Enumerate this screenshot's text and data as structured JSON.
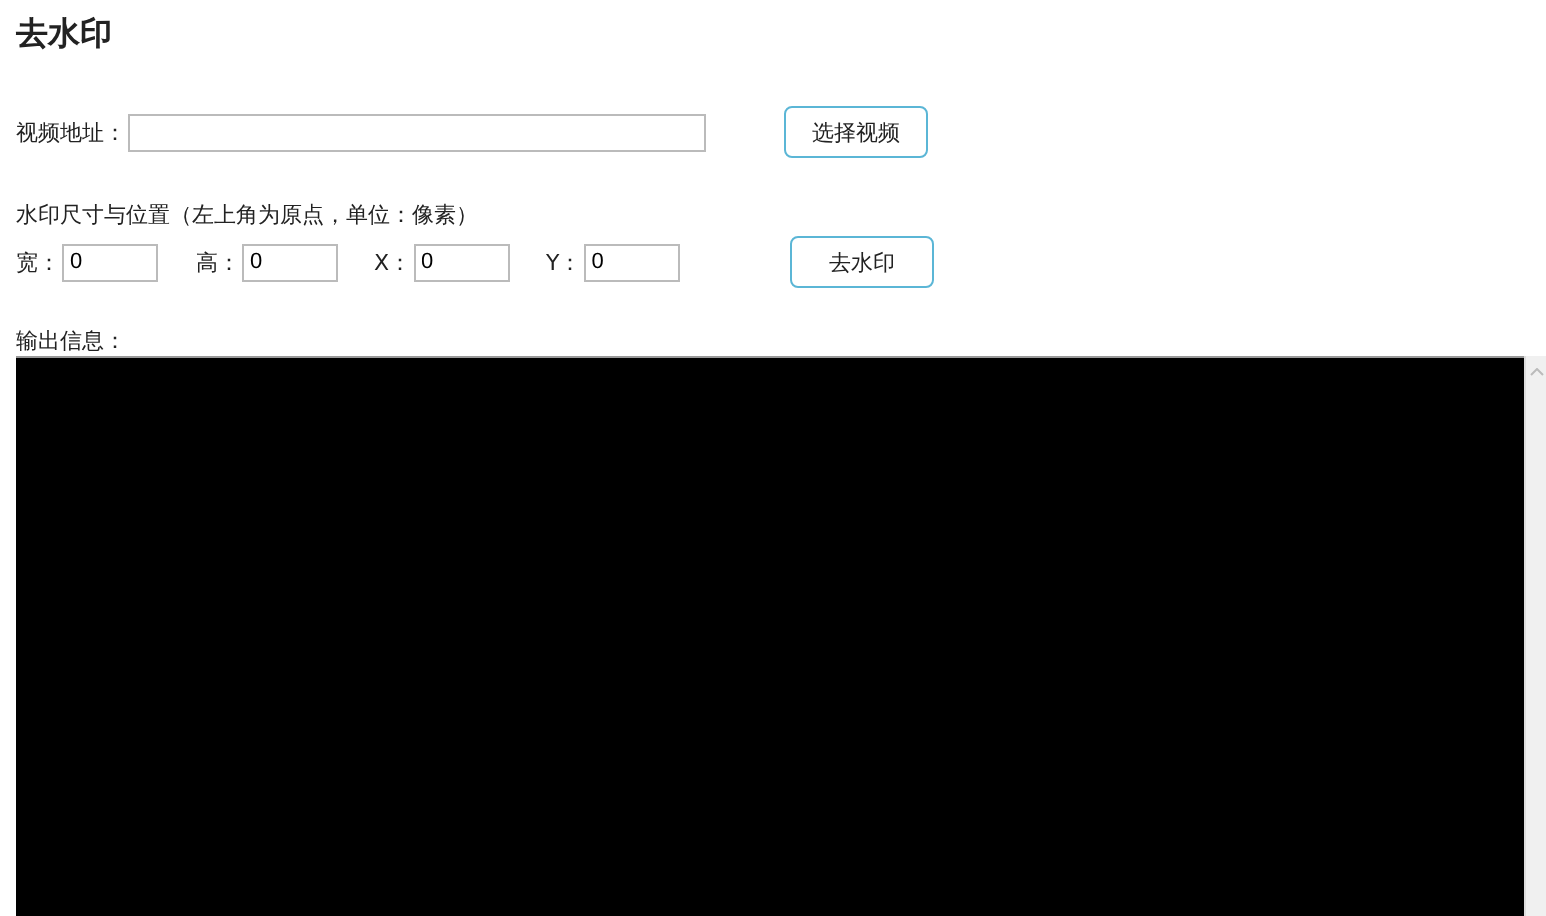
{
  "title": "去水印",
  "video": {
    "label": "视频地址：",
    "button": "选择视频"
  },
  "watermark": {
    "heading": "水印尺寸与位置（左上角为原点，单位：像素）",
    "fields": [
      {
        "label": "宽：",
        "value": "0"
      },
      {
        "label": "高：",
        "value": "0"
      },
      {
        "label": "X：",
        "value": "0"
      },
      {
        "label": "Y：",
        "value": "0"
      }
    ],
    "button": "去水印"
  },
  "output": {
    "label": "输出信息："
  }
}
